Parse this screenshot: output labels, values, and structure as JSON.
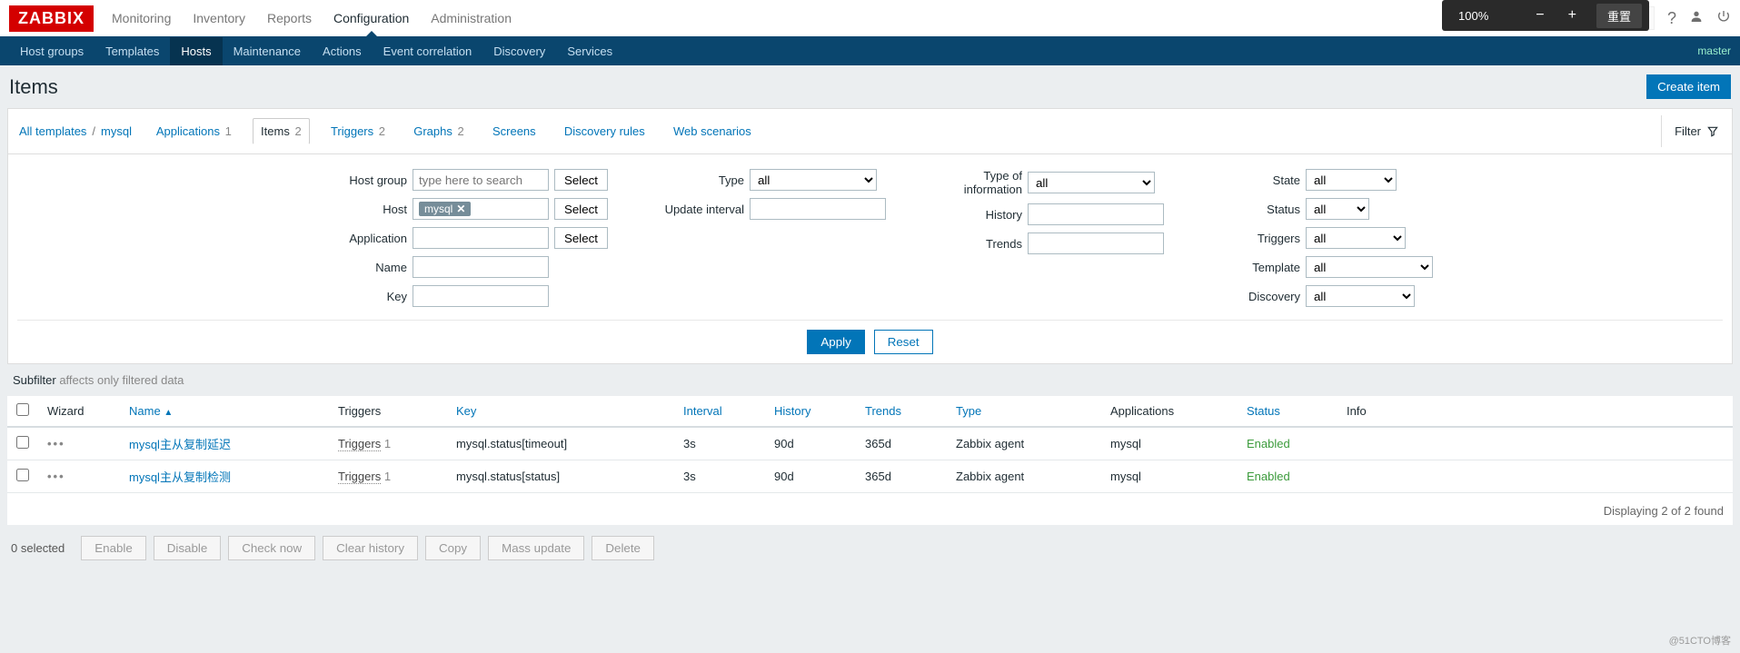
{
  "brand": "ZABBIX",
  "topnav": [
    "Monitoring",
    "Inventory",
    "Reports",
    "Configuration",
    "Administration"
  ],
  "topnav_active": "Configuration",
  "toolbox": {
    "zoom": "100%",
    "reset": "重置"
  },
  "subnav": [
    "Host groups",
    "Templates",
    "Hosts",
    "Maintenance",
    "Actions",
    "Event correlation",
    "Discovery",
    "Services"
  ],
  "subnav_active": "Hosts",
  "subnav_right": "master",
  "page_title": "Items",
  "create_btn": "Create item",
  "breadcrumb": {
    "all_templates": "All templates",
    "host_name": "mysql",
    "tabs": [
      {
        "label": "Applications",
        "count": "1"
      },
      {
        "label": "Items",
        "count": "2",
        "active": true
      },
      {
        "label": "Triggers",
        "count": "2"
      },
      {
        "label": "Graphs",
        "count": "2"
      },
      {
        "label": "Screens",
        "count": ""
      },
      {
        "label": "Discovery rules",
        "count": ""
      },
      {
        "label": "Web scenarios",
        "count": ""
      }
    ],
    "filter_label": "Filter"
  },
  "filter": {
    "labels": {
      "host_group": "Host group",
      "host": "Host",
      "application": "Application",
      "name": "Name",
      "key": "Key",
      "type": "Type",
      "update_interval": "Update interval",
      "type_of_info": "Type of information",
      "history": "History",
      "trends": "Trends",
      "state": "State",
      "status": "Status",
      "triggers": "Triggers",
      "template": "Template",
      "discovery": "Discovery"
    },
    "placeholder_search": "type here to search",
    "select": "Select",
    "host_tag": "mysql",
    "opt_all": "all",
    "apply": "Apply",
    "reset": "Reset"
  },
  "subfilter": {
    "title": "Subfilter",
    "note": "affects only filtered data"
  },
  "table": {
    "headers": {
      "wizard": "Wizard",
      "name": "Name",
      "triggers": "Triggers",
      "key": "Key",
      "interval": "Interval",
      "history": "History",
      "trends": "Trends",
      "type": "Type",
      "applications": "Applications",
      "status": "Status",
      "info": "Info"
    },
    "rows": [
      {
        "name": "mysql主从复制延迟",
        "triggers_label": "Triggers",
        "triggers_count": "1",
        "key": "mysql.status[timeout]",
        "interval": "3s",
        "history": "90d",
        "trends": "365d",
        "type": "Zabbix agent",
        "applications": "mysql",
        "status": "Enabled"
      },
      {
        "name": "mysql主从复制检测",
        "triggers_label": "Triggers",
        "triggers_count": "1",
        "key": "mysql.status[status]",
        "interval": "3s",
        "history": "90d",
        "trends": "365d",
        "type": "Zabbix agent",
        "applications": "mysql",
        "status": "Enabled"
      }
    ],
    "footer": "Displaying 2 of 2 found"
  },
  "bulk": {
    "selected": "0 selected",
    "buttons": [
      "Enable",
      "Disable",
      "Check now",
      "Clear history",
      "Copy",
      "Mass update",
      "Delete"
    ]
  },
  "watermark": "@51CTO博客"
}
